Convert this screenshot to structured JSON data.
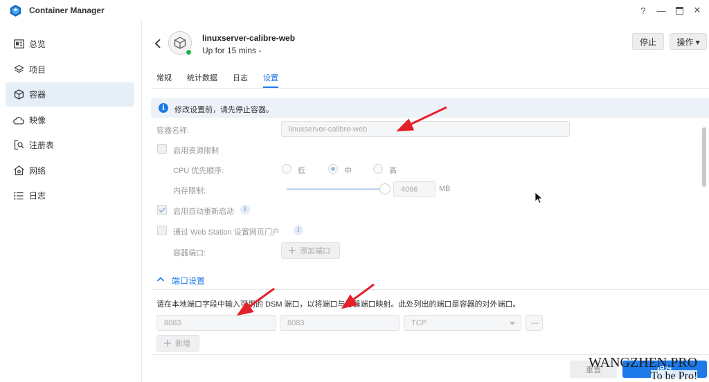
{
  "app": {
    "title": "Container Manager",
    "logo_icon": "container-manager-logo-icon",
    "brand_color": "#1d7ae8"
  },
  "window_controls": {
    "help": "?",
    "minimize": "—",
    "maximize": "□",
    "close": "✕"
  },
  "sidebar": {
    "items": [
      {
        "label": "总览",
        "icon": "overview-icon",
        "active": false
      },
      {
        "label": "项目",
        "icon": "project-layers-icon",
        "active": false
      },
      {
        "label": "容器",
        "icon": "container-cube-icon",
        "active": true
      },
      {
        "label": "映像",
        "icon": "image-cloud-icon",
        "active": false
      },
      {
        "label": "注册表",
        "icon": "registry-search-icon",
        "active": false
      },
      {
        "label": "网络",
        "icon": "network-house-icon",
        "active": false
      },
      {
        "label": "日志",
        "icon": "log-list-icon",
        "active": false
      }
    ]
  },
  "header": {
    "container_name": "linuxserver-calibre-web",
    "status_text": "Up for 15 mins -",
    "status_color": "#24b33f",
    "stop_label": "停止",
    "action_label": "操作 ▾"
  },
  "tabs": [
    {
      "label": "常规",
      "active": false
    },
    {
      "label": "统计数据",
      "active": false
    },
    {
      "label": "日志",
      "active": false
    },
    {
      "label": "设置",
      "active": true
    }
  ],
  "settings": {
    "info_icon": "i",
    "info_text": "修改设置前，请先停止容器。",
    "container_name_label": "容器名称:",
    "container_name_value": "linuxserver-calibre-web",
    "resource_limit_label": "启用资源限制",
    "cpu_priority_label": "CPU 优先顺序:",
    "cpu_low": "低",
    "cpu_mid": "中",
    "cpu_high": "高",
    "memory_limit_label": "内存限制:",
    "memory_value": "4096",
    "memory_unit": "MB",
    "memory_slider_fraction": 1.0,
    "auto_restart_label": "启用自动重新启动",
    "auto_restart_checked": true,
    "web_station_label": "通过 Web Station 设置网页门户",
    "container_port_label": "容器端口:",
    "add_port_label": "添加端口"
  },
  "port_settings": {
    "section_title": "端口设置",
    "description": "请在本地端口字段中输入可用的 DSM 端口，以将端口与容器端口映射。此处列出的端口是容器的对外端口。",
    "local_port": "8083",
    "container_port": "8083",
    "protocol": "TCP",
    "remove_label": "—",
    "add_label": "新增"
  },
  "footer": {
    "reset_label": "重置",
    "save_label": "保存"
  },
  "watermark": {
    "line1": "WANGZHEN.PRO",
    "line2": "To be Pro!"
  }
}
